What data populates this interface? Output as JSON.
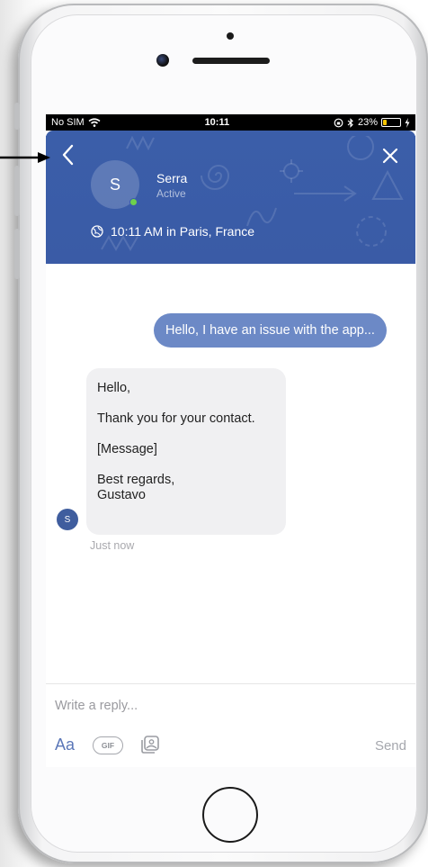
{
  "status_bar": {
    "carrier": "No SIM",
    "time": "10:11",
    "battery": "23%",
    "battery_level": 0.23
  },
  "header": {
    "agent_initial": "S",
    "agent_name": "Serra",
    "agent_status": "Active",
    "local_time": "10:11 AM in Paris, France",
    "accent_color": "#3b5ea9",
    "online_color": "#6ed14b"
  },
  "conversation": {
    "outgoing": "Hello, I have an issue with the app...",
    "incoming_lines": [
      "Hello,",
      "",
      "Thank you for your contact.",
      "",
      "[Message]",
      "",
      "Best regards,",
      "Gustavo"
    ],
    "avatar_initial": "S",
    "timestamp": "Just now"
  },
  "composer": {
    "placeholder": "Write a reply...",
    "format_label": "Aa",
    "gif_label": "GIF",
    "send_label": "Send"
  },
  "icons": [
    "back-chevron-icon",
    "close-icon",
    "globe-icon",
    "wifi-icon",
    "bluetooth-icon",
    "battery-icon",
    "image-icon",
    "arrow-icon"
  ]
}
